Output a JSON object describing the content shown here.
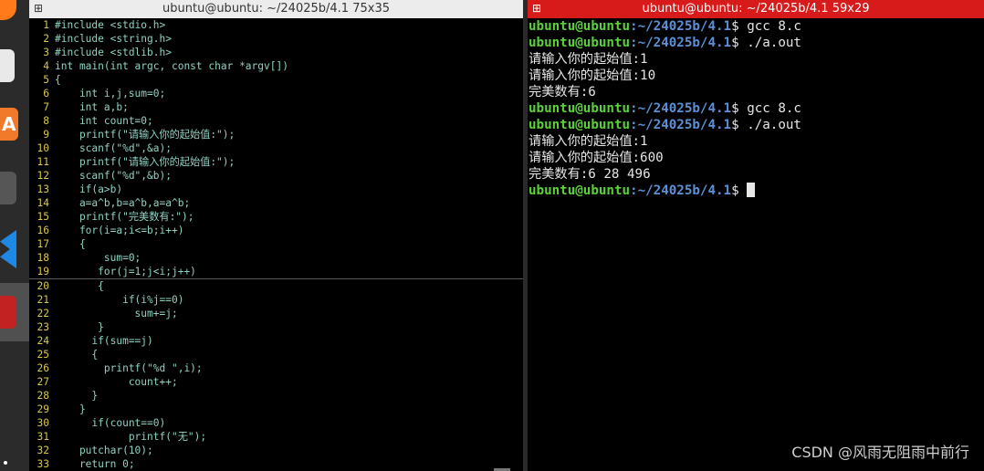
{
  "dock": {
    "items": [
      "firefox-icon",
      "files-icon",
      "app-store-icon",
      "settings-icon",
      "vscode-icon",
      "terminal-icon"
    ],
    "store_glyph": "A"
  },
  "left_window": {
    "title": "ubuntu@ubuntu: ~/24025b/4.1 75x35",
    "lines": [
      {
        "n": "1",
        "t": "#include <stdio.h>"
      },
      {
        "n": "2",
        "t": "#include <string.h>"
      },
      {
        "n": "3",
        "t": "#include <stdlib.h>"
      },
      {
        "n": "4",
        "t": "int main(int argc, const char *argv[])"
      },
      {
        "n": "5",
        "t": "{"
      },
      {
        "n": "6",
        "t": "    int i,j,sum=0;"
      },
      {
        "n": "7",
        "t": "    int a,b;"
      },
      {
        "n": "8",
        "t": "    int count=0;"
      },
      {
        "n": "9",
        "t": "    printf(\"请输入你的起始值:\");"
      },
      {
        "n": "10",
        "t": "    scanf(\"%d\",&a);"
      },
      {
        "n": "11",
        "t": "    printf(\"请输入你的起始值:\");"
      },
      {
        "n": "12",
        "t": "    scanf(\"%d\",&b);"
      },
      {
        "n": "13",
        "t": "    if(a>b)"
      },
      {
        "n": "14",
        "t": "    a=a^b,b=a^b,a=a^b;"
      },
      {
        "n": "15",
        "t": "    printf(\"完美数有:\");"
      },
      {
        "n": "16",
        "t": "    for(i=a;i<=b;i++)"
      },
      {
        "n": "17",
        "t": "    {"
      },
      {
        "n": "18",
        "t": "        sum=0;"
      },
      {
        "n": "19",
        "t": "       for(j=1;j<i;j++)"
      },
      {
        "n": "20",
        "t": "       {"
      },
      {
        "n": "21",
        "t": "           if(i%j==0)"
      },
      {
        "n": "22",
        "t": "             sum+=j;"
      },
      {
        "n": "23",
        "t": "       }"
      },
      {
        "n": "24",
        "t": "      if(sum==j)"
      },
      {
        "n": "25",
        "t": "      {"
      },
      {
        "n": "26",
        "t": "        printf(\"%d \",i);"
      },
      {
        "n": "27",
        "t": "            count++;"
      },
      {
        "n": "28",
        "t": "      }"
      },
      {
        "n": "29",
        "t": "    }"
      },
      {
        "n": "30",
        "t": "      if(count==0)"
      },
      {
        "n": "31",
        "t": "            printf(\"无\");"
      },
      {
        "n": "32",
        "t": "    putchar(10);"
      },
      {
        "n": "33",
        "t": "    return 0;"
      }
    ],
    "cursor_line": "19"
  },
  "right_window": {
    "title": "ubuntu@ubuntu: ~/24025b/4.1 59x29",
    "prompt_user": "ubuntu@ubuntu",
    "prompt_path": ":~/24025b/4.1",
    "prompt_symbol": "$ ",
    "lines": [
      {
        "type": "prompt",
        "cmd": "gcc 8.c"
      },
      {
        "type": "prompt",
        "cmd": "./a.out"
      },
      {
        "type": "output",
        "text": "请输入你的起始值:1"
      },
      {
        "type": "output",
        "text": "请输入你的起始值:10"
      },
      {
        "type": "output",
        "text": "完美数有:6"
      },
      {
        "type": "prompt",
        "cmd": "gcc 8.c"
      },
      {
        "type": "prompt",
        "cmd": "./a.out"
      },
      {
        "type": "output",
        "text": "请输入你的起始值:1"
      },
      {
        "type": "output",
        "text": "请输入你的起始值:600"
      },
      {
        "type": "output",
        "text": "完美数有:6 28 496"
      },
      {
        "type": "prompt",
        "cmd": ""
      }
    ]
  },
  "watermark": "CSDN @风雨无阻雨中前行",
  "colors": {
    "right_title_bg": "#d71a1a",
    "prompt_user": "#5bd13a",
    "prompt_path": "#5b8fd6",
    "code_text": "#8fd2c3",
    "line_number": "#d8c94a"
  }
}
